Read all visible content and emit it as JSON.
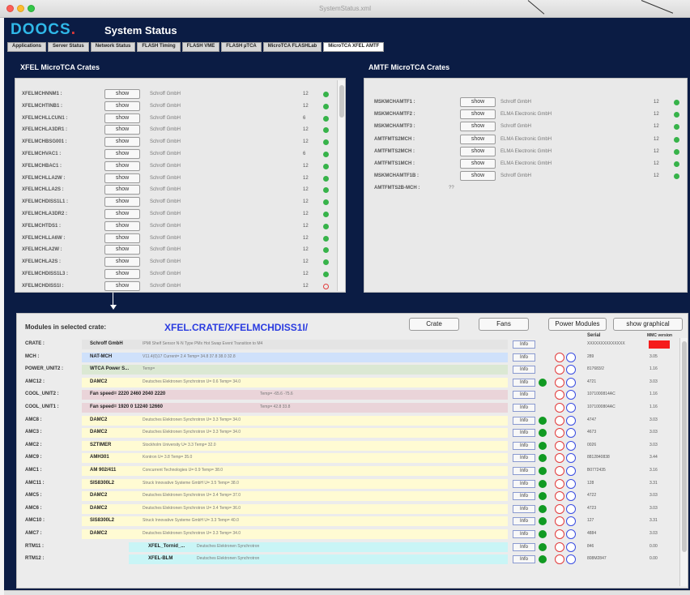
{
  "window": {
    "title": "SystemStatus.xml"
  },
  "app": {
    "logo": "DOOCS",
    "logo_dot": ".",
    "title": "System Status"
  },
  "tabs": [
    {
      "label": "Applications"
    },
    {
      "label": "Server Status"
    },
    {
      "label": "Network Status"
    },
    {
      "label": "FLASH Timing"
    },
    {
      "label": "FLASH VME"
    },
    {
      "label": "FLASH µTCA"
    },
    {
      "label": "MicroTCA FLASHLab"
    },
    {
      "label": "MicroTCA XFEL AMTF"
    }
  ],
  "xfel_panel": {
    "title": "XFEL MicroTCA Crates",
    "show_label": "show",
    "crates": [
      {
        "name": "XFELMCHNNM1 :",
        "vendor": "Schroff GmbH",
        "slots": "12",
        "ok": true
      },
      {
        "name": "XFELMCHTINB1 :",
        "vendor": "Schroff GmbH",
        "slots": "12",
        "ok": true
      },
      {
        "name": "XFELMCHLLCUN1 :",
        "vendor": "Schroff GmbH",
        "slots": "6",
        "ok": true
      },
      {
        "name": "XFELMCHLA3DR1 :",
        "vendor": "Schroff GmbH",
        "slots": "12",
        "ok": true
      },
      {
        "name": "XFELMCHBSG001 :",
        "vendor": "Schroff GmbH",
        "slots": "12",
        "ok": true
      },
      {
        "name": "XFELMCHVAC1 :",
        "vendor": "Schroff GmbH",
        "slots": "6",
        "ok": true
      },
      {
        "name": "XFELMCHBAC1 :",
        "vendor": "Schroff GmbH",
        "slots": "12",
        "ok": true
      },
      {
        "name": "XFELMCHLLA2W :",
        "vendor": "Schroff GmbH",
        "slots": "12",
        "ok": true
      },
      {
        "name": "XFELMCHLLA2S :",
        "vendor": "Schroff GmbH",
        "slots": "12",
        "ok": true
      },
      {
        "name": "XFELMCHDISS1L1 :",
        "vendor": "Schroff GmbH",
        "slots": "12",
        "ok": true
      },
      {
        "name": "XFELMCHLA3DR2 :",
        "vendor": "Schroff GmbH",
        "slots": "12",
        "ok": true
      },
      {
        "name": "XFELMCHTDS1 :",
        "vendor": "Schroff GmbH",
        "slots": "12",
        "ok": true
      },
      {
        "name": "XFELMCHLLA6W :",
        "vendor": "Schroff GmbH",
        "slots": "12",
        "ok": true
      },
      {
        "name": "XFELMCHLA2W :",
        "vendor": "Schroff GmbH",
        "slots": "12",
        "ok": true
      },
      {
        "name": "XFELMCHLA2S :",
        "vendor": "Schroff GmbH",
        "slots": "12",
        "ok": true
      },
      {
        "name": "XFELMCHDISS1L3 :",
        "vendor": "Schroff GmbH",
        "slots": "12",
        "ok": true
      },
      {
        "name": "XFELMCHDISS1I :",
        "vendor": "Schroff GmbH",
        "slots": "12",
        "ok": false
      }
    ]
  },
  "amtf_panel": {
    "title": "AMTF MicroTCA Crates",
    "show_label": "show",
    "crates": [
      {
        "name": "MSKMCHAMTF1 :",
        "vendor": "Schroff GmbH",
        "slots": "12",
        "ok": true,
        "show": true
      },
      {
        "name": "MSKMCHAMTF2 :",
        "vendor": "ELMA Electronic GmbH",
        "slots": "12",
        "ok": true,
        "show": true
      },
      {
        "name": "MSKMCHAMTF3 :",
        "vendor": "Schroff GmbH",
        "slots": "12",
        "ok": true,
        "show": true
      },
      {
        "name": "AMTFMTS2MCH :",
        "vendor": "ELMA Electronic GmbH",
        "slots": "12",
        "ok": true,
        "show": true
      },
      {
        "name": "AMTFMTS2MCH :",
        "vendor": "ELMA Electronic GmbH",
        "slots": "12",
        "ok": true,
        "show": true
      },
      {
        "name": "AMTFMTS1MCH :",
        "vendor": "ELMA Electronic GmbH",
        "slots": "12",
        "ok": true,
        "show": true
      },
      {
        "name": "MSKMCHAMTF1B :",
        "vendor": "Schroff GmbH",
        "slots": "12",
        "ok": true,
        "show": true
      },
      {
        "name": "AMTFMTS2B-MCH :",
        "vendor": "??",
        "slots": "",
        "ok": null,
        "show": false
      }
    ]
  },
  "modules": {
    "title": "Modules in selected crate:",
    "crate": "XFEL.CRATE/XFELMCHDISS1I/",
    "buttons": {
      "crate": "Crate",
      "fans": "Fans",
      "power": "Power Modules",
      "graphical": "show graphical"
    },
    "col_serial": "Serial",
    "col_fw": "MMC version",
    "info_label": "Info",
    "rows": [
      {
        "label": "CRATE :",
        "name": "Schroff GmbH",
        "desc": "IPMI Shelf Sensor N·N Type PMx Hot Swap Event Transition to M4",
        "color": "plain",
        "led": false,
        "rings": false,
        "serial": "XXXXXXXXXXXXXX",
        "fw": "",
        "fw_red": true
      },
      {
        "label": "MCH :",
        "name": "NAT-MCH",
        "desc": "V11.4(0)17     Current=  2.4     Temp=  34.8    37.8    38.0    32.8",
        "color": "blue",
        "led": false,
        "rings": true,
        "serial": "289",
        "fw": "3.05",
        "fw_red": false
      },
      {
        "label": "POWER_UNIT2 :",
        "name": "WTCA Power S...",
        "desc": "                                                                  Temp=",
        "color": "green",
        "led": false,
        "rings": true,
        "serial": "817683/2",
        "fw": "1.16",
        "fw_red": false
      },
      {
        "label": "AMC12 :",
        "name": "DAMC2",
        "desc": "Deutsches Elektronen Synchrotron        U=  0.6        Temp=  34.0",
        "color": "yellow",
        "led": true,
        "rings": true,
        "serial": "4721",
        "fw": "3.03",
        "fw_red": false
      },
      {
        "label": "COOL_UNIT2 :",
        "name": "Fan speed=   2220   2460   2040   2220",
        "desc": "      Temp=  -65.6   -75.6",
        "color": "pink",
        "led": false,
        "rings": true,
        "serial": "1071000814AC",
        "fw": "1.16",
        "fw_red": false
      },
      {
        "label": "COOL_UNIT1 :",
        "name": "Fan speed=   1920   0      12240   12660",
        "desc": "      Temp=  42.8   33.8",
        "color": "pink",
        "led": false,
        "rings": true,
        "serial": "1071000804AC",
        "fw": "1.16",
        "fw_red": false
      },
      {
        "label": "AMC8 :",
        "name": "DAMC2",
        "desc": "Deutsches Elektronen Synchrotron        U=  3.3        Temp=  34.0",
        "color": "yellow",
        "led": true,
        "rings": true,
        "serial": "4747",
        "fw": "3.03",
        "fw_red": false
      },
      {
        "label": "AMC3 :",
        "name": "DAMC2",
        "desc": "Deutsches Elektronen Synchrotron        U=  3.3        Temp=  34.0",
        "color": "yellow",
        "led": true,
        "rings": true,
        "serial": "4673",
        "fw": "3.03",
        "fw_red": false
      },
      {
        "label": "AMC2 :",
        "name": "SZTIMER",
        "desc": "Stockholm University                    U=  3.3        Temp=  32.0",
        "color": "yellow",
        "led": true,
        "rings": true,
        "serial": "0026",
        "fw": "3.03",
        "fw_red": false
      },
      {
        "label": "AMC9 :",
        "name": "AMH301",
        "desc": "Kontron                                 U=  3.8        Temp=  35.0",
        "color": "yellow",
        "led": true,
        "rings": true,
        "serial": "8812840838",
        "fw": "3.44",
        "fw_red": false
      },
      {
        "label": "AMC1 :",
        "name": "AM 902/411",
        "desc": "Concurrent Technologies                 U=  0.9        Temp=  38.0",
        "color": "yellow",
        "led": true,
        "rings": true,
        "serial": "B0772435",
        "fw": "3.16",
        "fw_red": false
      },
      {
        "label": "AMC11 :",
        "name": "SIS8300L2",
        "desc": "Struck Innovative Systeme GmbH          U=  3.5        Temp=  38.0",
        "color": "yellow",
        "led": true,
        "rings": true,
        "serial": "128",
        "fw": "3.31",
        "fw_red": false
      },
      {
        "label": "AMC5 :",
        "name": "DAMC2",
        "desc": "Deutsches Elektronen Synchrotron        U=  3.4        Temp=  37.0",
        "color": "yellow",
        "led": true,
        "rings": true,
        "serial": "4722",
        "fw": "3.03",
        "fw_red": false
      },
      {
        "label": "AMC6 :",
        "name": "DAMC2",
        "desc": "Deutsches Elektronen Synchrotron        U=  3.4        Temp=  36.0",
        "color": "yellow",
        "led": true,
        "rings": true,
        "serial": "4723",
        "fw": "3.03",
        "fw_red": false
      },
      {
        "label": "AMC10 :",
        "name": "SIS8300L2",
        "desc": "Struck Innovative Systeme GmbH          U=  3.3        Temp=  40.0",
        "color": "yellow",
        "led": true,
        "rings": true,
        "serial": "127",
        "fw": "3.31",
        "fw_red": false
      },
      {
        "label": "AMC7 :",
        "name": "DAMC2",
        "desc": "Deutsches Elektronen Synchrotron        U=  3.3        Temp=  34.0",
        "color": "yellow",
        "led": true,
        "rings": true,
        "serial": "4884",
        "fw": "3.03",
        "fw_red": false
      },
      {
        "label": "RTM11 :",
        "name": "XFEL_Tornid_...",
        "desc": "Deutsches Elektronen Synchrotron",
        "color": "cyan",
        "led": true,
        "rings": true,
        "serial": "846",
        "fw": "0.00",
        "fw_red": false
      },
      {
        "label": "RTM12 :",
        "name": "XFEL-BLM",
        "desc": "Deutsches Elektronen Synchrotron",
        "color": "cyan",
        "led": true,
        "rings": true,
        "serial": "808M2847",
        "fw": "0.00",
        "fw_red": false
      }
    ]
  }
}
